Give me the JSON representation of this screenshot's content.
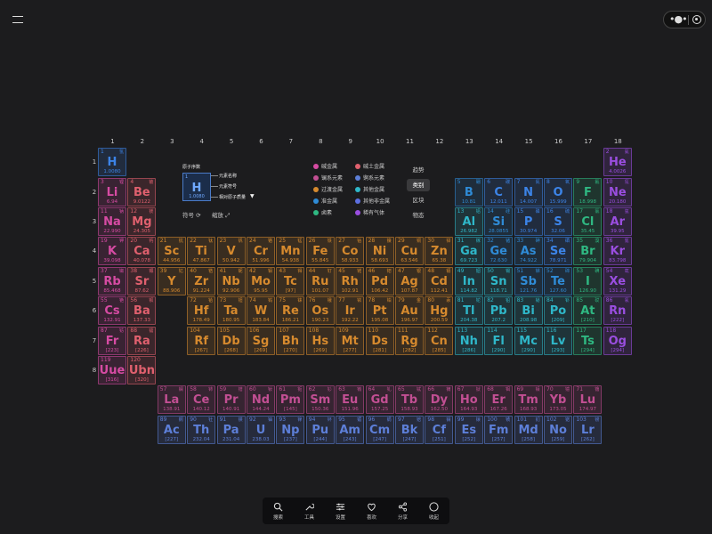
{
  "columns": [
    "1",
    "2",
    "3",
    "4",
    "5",
    "6",
    "7",
    "8",
    "9",
    "10",
    "11",
    "12",
    "13",
    "14",
    "15",
    "16",
    "17",
    "18"
  ],
  "rows": [
    "1",
    "2",
    "3",
    "4",
    "5",
    "6",
    "7",
    "8"
  ],
  "legend_key": {
    "atomic_number_label": "原子序数",
    "element_name_label": "元素名称",
    "element_symbol_label": "元素符号",
    "atomic_mass_label": "相对原子质量",
    "sample_number": "1",
    "sample_symbol": "H",
    "sample_mass": "1.0080"
  },
  "tools": {
    "symbol_label": "符号",
    "zoom_label": "缩放"
  },
  "categories": [
    {
      "label": "碱金属",
      "color": "#d64ba3"
    },
    {
      "label": "碱土金属",
      "color": "#e0606e"
    },
    {
      "label": "镧系元素",
      "color": "#c24f93"
    },
    {
      "label": "锕系元素",
      "color": "#5d7fd8"
    },
    {
      "label": "过渡金属",
      "color": "#d68a2e"
    },
    {
      "label": "其他金属",
      "color": "#2fb7c9"
    },
    {
      "label": "准金属",
      "color": "#2f8bd6"
    },
    {
      "label": "其他非金属",
      "color": "#5c6fe0"
    },
    {
      "label": "卤素",
      "color": "#2fb882"
    },
    {
      "label": "稀有气体",
      "color": "#9a4ee0"
    }
  ],
  "view_tabs": [
    {
      "label": "趋势",
      "active": false
    },
    {
      "label": "类别",
      "active": true
    },
    {
      "label": "区块",
      "active": false
    },
    {
      "label": "物态",
      "active": false
    }
  ],
  "bottom_bar": [
    {
      "label": "搜索",
      "icon": "search-icon"
    },
    {
      "label": "工具",
      "icon": "wrench-icon"
    },
    {
      "label": "设置",
      "icon": "sliders-icon"
    },
    {
      "label": "喜欢",
      "icon": "heart-icon"
    },
    {
      "label": "分享",
      "icon": "share-icon"
    },
    {
      "label": "收起",
      "icon": "collapse-icon"
    }
  ],
  "category_colors": {
    "alkali": "#d64ba3",
    "alkaline": "#e0606e",
    "transition": "#d68a2e",
    "post": "#2fb7c9",
    "metalloid": "#2f8bd6",
    "nonmetal": "#3c84e8",
    "halogen": "#2fb882",
    "noble": "#9a4ee0",
    "lanthanide": "#c24f93",
    "actinide": "#5d7fd8"
  },
  "elements": [
    {
      "n": "1",
      "s": "H",
      "c": "氢",
      "m": "1.0080",
      "g": 1,
      "p": 1,
      "cat": "nonmetal"
    },
    {
      "n": "2",
      "s": "He",
      "c": "氦",
      "m": "4.0026",
      "g": 18,
      "p": 1,
      "cat": "noble"
    },
    {
      "n": "3",
      "s": "Li",
      "c": "锂",
      "m": "6.94",
      "g": 1,
      "p": 2,
      "cat": "alkali"
    },
    {
      "n": "4",
      "s": "Be",
      "c": "铍",
      "m": "9.0122",
      "g": 2,
      "p": 2,
      "cat": "alkaline"
    },
    {
      "n": "5",
      "s": "B",
      "c": "硼",
      "m": "10.81",
      "g": 13,
      "p": 2,
      "cat": "metalloid"
    },
    {
      "n": "6",
      "s": "C",
      "c": "碳",
      "m": "12.011",
      "g": 14,
      "p": 2,
      "cat": "nonmetal"
    },
    {
      "n": "7",
      "s": "N",
      "c": "氮",
      "m": "14.007",
      "g": 15,
      "p": 2,
      "cat": "nonmetal"
    },
    {
      "n": "8",
      "s": "O",
      "c": "氧",
      "m": "15.999",
      "g": 16,
      "p": 2,
      "cat": "nonmetal"
    },
    {
      "n": "9",
      "s": "F",
      "c": "氟",
      "m": "18.998",
      "g": 17,
      "p": 2,
      "cat": "halogen"
    },
    {
      "n": "10",
      "s": "Ne",
      "c": "氖",
      "m": "20.180",
      "g": 18,
      "p": 2,
      "cat": "noble"
    },
    {
      "n": "11",
      "s": "Na",
      "c": "钠",
      "m": "22.990",
      "g": 1,
      "p": 3,
      "cat": "alkali"
    },
    {
      "n": "12",
      "s": "Mg",
      "c": "镁",
      "m": "24.305",
      "g": 2,
      "p": 3,
      "cat": "alkaline"
    },
    {
      "n": "13",
      "s": "Al",
      "c": "铝",
      "m": "26.982",
      "g": 13,
      "p": 3,
      "cat": "post"
    },
    {
      "n": "14",
      "s": "Si",
      "c": "硅",
      "m": "28.0855",
      "g": 14,
      "p": 3,
      "cat": "metalloid"
    },
    {
      "n": "15",
      "s": "P",
      "c": "磷",
      "m": "30.974",
      "g": 15,
      "p": 3,
      "cat": "nonmetal"
    },
    {
      "n": "16",
      "s": "S",
      "c": "硫",
      "m": "32.06",
      "g": 16,
      "p": 3,
      "cat": "nonmetal"
    },
    {
      "n": "17",
      "s": "Cl",
      "c": "氯",
      "m": "35.45",
      "g": 17,
      "p": 3,
      "cat": "halogen"
    },
    {
      "n": "18",
      "s": "Ar",
      "c": "氩",
      "m": "39.95",
      "g": 18,
      "p": 3,
      "cat": "noble"
    },
    {
      "n": "19",
      "s": "K",
      "c": "钾",
      "m": "39.098",
      "g": 1,
      "p": 4,
      "cat": "alkali"
    },
    {
      "n": "20",
      "s": "Ca",
      "c": "钙",
      "m": "40.078",
      "g": 2,
      "p": 4,
      "cat": "alkaline"
    },
    {
      "n": "21",
      "s": "Sc",
      "c": "钪",
      "m": "44.956",
      "g": 3,
      "p": 4,
      "cat": "transition"
    },
    {
      "n": "22",
      "s": "Ti",
      "c": "钛",
      "m": "47.867",
      "g": 4,
      "p": 4,
      "cat": "transition"
    },
    {
      "n": "23",
      "s": "V",
      "c": "钒",
      "m": "50.942",
      "g": 5,
      "p": 4,
      "cat": "transition"
    },
    {
      "n": "24",
      "s": "Cr",
      "c": "铬",
      "m": "51.996",
      "g": 6,
      "p": 4,
      "cat": "transition"
    },
    {
      "n": "25",
      "s": "Mn",
      "c": "锰",
      "m": "54.938",
      "g": 7,
      "p": 4,
      "cat": "transition"
    },
    {
      "n": "26",
      "s": "Fe",
      "c": "铁",
      "m": "55.845",
      "g": 8,
      "p": 4,
      "cat": "transition"
    },
    {
      "n": "27",
      "s": "Co",
      "c": "钴",
      "m": "58.933",
      "g": 9,
      "p": 4,
      "cat": "transition"
    },
    {
      "n": "28",
      "s": "Ni",
      "c": "镍",
      "m": "58.693",
      "g": 10,
      "p": 4,
      "cat": "transition"
    },
    {
      "n": "29",
      "s": "Cu",
      "c": "铜",
      "m": "63.546",
      "g": 11,
      "p": 4,
      "cat": "transition"
    },
    {
      "n": "30",
      "s": "Zn",
      "c": "锌",
      "m": "65.38",
      "g": 12,
      "p": 4,
      "cat": "transition"
    },
    {
      "n": "31",
      "s": "Ga",
      "c": "镓",
      "m": "69.723",
      "g": 13,
      "p": 4,
      "cat": "post"
    },
    {
      "n": "32",
      "s": "Ge",
      "c": "锗",
      "m": "72.630",
      "g": 14,
      "p": 4,
      "cat": "metalloid"
    },
    {
      "n": "33",
      "s": "As",
      "c": "砷",
      "m": "74.922",
      "g": 15,
      "p": 4,
      "cat": "metalloid"
    },
    {
      "n": "34",
      "s": "Se",
      "c": "硒",
      "m": "78.971",
      "g": 16,
      "p": 4,
      "cat": "nonmetal"
    },
    {
      "n": "35",
      "s": "Br",
      "c": "溴",
      "m": "79.904",
      "g": 17,
      "p": 4,
      "cat": "halogen"
    },
    {
      "n": "36",
      "s": "Kr",
      "c": "氪",
      "m": "83.798",
      "g": 18,
      "p": 4,
      "cat": "noble"
    },
    {
      "n": "37",
      "s": "Rb",
      "c": "铷",
      "m": "85.468",
      "g": 1,
      "p": 5,
      "cat": "alkali"
    },
    {
      "n": "38",
      "s": "Sr",
      "c": "锶",
      "m": "87.62",
      "g": 2,
      "p": 5,
      "cat": "alkaline"
    },
    {
      "n": "39",
      "s": "Y",
      "c": "钇",
      "m": "88.906",
      "g": 3,
      "p": 5,
      "cat": "transition"
    },
    {
      "n": "40",
      "s": "Zr",
      "c": "锆",
      "m": "91.224",
      "g": 4,
      "p": 5,
      "cat": "transition"
    },
    {
      "n": "41",
      "s": "Nb",
      "c": "铌",
      "m": "92.906",
      "g": 5,
      "p": 5,
      "cat": "transition"
    },
    {
      "n": "42",
      "s": "Mo",
      "c": "钼",
      "m": "95.95",
      "g": 6,
      "p": 5,
      "cat": "transition"
    },
    {
      "n": "43",
      "s": "Tc",
      "c": "锝",
      "m": "[97]",
      "g": 7,
      "p": 5,
      "cat": "transition"
    },
    {
      "n": "44",
      "s": "Ru",
      "c": "钌",
      "m": "101.07",
      "g": 8,
      "p": 5,
      "cat": "transition"
    },
    {
      "n": "45",
      "s": "Rh",
      "c": "铑",
      "m": "102.91",
      "g": 9,
      "p": 5,
      "cat": "transition"
    },
    {
      "n": "46",
      "s": "Pd",
      "c": "钯",
      "m": "106.42",
      "g": 10,
      "p": 5,
      "cat": "transition"
    },
    {
      "n": "47",
      "s": "Ag",
      "c": "银",
      "m": "107.87",
      "g": 11,
      "p": 5,
      "cat": "transition"
    },
    {
      "n": "48",
      "s": "Cd",
      "c": "镉",
      "m": "112.41",
      "g": 12,
      "p": 5,
      "cat": "transition"
    },
    {
      "n": "49",
      "s": "In",
      "c": "铟",
      "m": "114.82",
      "g": 13,
      "p": 5,
      "cat": "post"
    },
    {
      "n": "50",
      "s": "Sn",
      "c": "锡",
      "m": "118.71",
      "g": 14,
      "p": 5,
      "cat": "post"
    },
    {
      "n": "51",
      "s": "Sb",
      "c": "锑",
      "m": "121.76",
      "g": 15,
      "p": 5,
      "cat": "metalloid"
    },
    {
      "n": "52",
      "s": "Te",
      "c": "碲",
      "m": "127.60",
      "g": 16,
      "p": 5,
      "cat": "metalloid"
    },
    {
      "n": "53",
      "s": "I",
      "c": "碘",
      "m": "126.90",
      "g": 17,
      "p": 5,
      "cat": "halogen"
    },
    {
      "n": "54",
      "s": "Xe",
      "c": "氙",
      "m": "131.29",
      "g": 18,
      "p": 5,
      "cat": "noble"
    },
    {
      "n": "55",
      "s": "Cs",
      "c": "铯",
      "m": "132.91",
      "g": 1,
      "p": 6,
      "cat": "alkali"
    },
    {
      "n": "56",
      "s": "Ba",
      "c": "钡",
      "m": "137.33",
      "g": 2,
      "p": 6,
      "cat": "alkaline"
    },
    {
      "n": "72",
      "s": "Hf",
      "c": "铪",
      "m": "178.49",
      "g": 4,
      "p": 6,
      "cat": "transition"
    },
    {
      "n": "73",
      "s": "Ta",
      "c": "钽",
      "m": "180.95",
      "g": 5,
      "p": 6,
      "cat": "transition"
    },
    {
      "n": "74",
      "s": "W",
      "c": "钨",
      "m": "183.84",
      "g": 6,
      "p": 6,
      "cat": "transition"
    },
    {
      "n": "75",
      "s": "Re",
      "c": "铼",
      "m": "186.21",
      "g": 7,
      "p": 6,
      "cat": "transition"
    },
    {
      "n": "76",
      "s": "Os",
      "c": "锇",
      "m": "190.23",
      "g": 8,
      "p": 6,
      "cat": "transition"
    },
    {
      "n": "77",
      "s": "Ir",
      "c": "铱",
      "m": "192.22",
      "g": 9,
      "p": 6,
      "cat": "transition"
    },
    {
      "n": "78",
      "s": "Pt",
      "c": "铂",
      "m": "195.08",
      "g": 10,
      "p": 6,
      "cat": "transition"
    },
    {
      "n": "79",
      "s": "Au",
      "c": "金",
      "m": "196.97",
      "g": 11,
      "p": 6,
      "cat": "transition"
    },
    {
      "n": "80",
      "s": "Hg",
      "c": "汞",
      "m": "200.59",
      "g": 12,
      "p": 6,
      "cat": "transition"
    },
    {
      "n": "81",
      "s": "Tl",
      "c": "铊",
      "m": "204.38",
      "g": 13,
      "p": 6,
      "cat": "post"
    },
    {
      "n": "82",
      "s": "Pb",
      "c": "铅",
      "m": "207.2",
      "g": 14,
      "p": 6,
      "cat": "post"
    },
    {
      "n": "83",
      "s": "Bi",
      "c": "铋",
      "m": "208.98",
      "g": 15,
      "p": 6,
      "cat": "post"
    },
    {
      "n": "84",
      "s": "Po",
      "c": "钋",
      "m": "[209]",
      "g": 16,
      "p": 6,
      "cat": "post"
    },
    {
      "n": "85",
      "s": "At",
      "c": "砹",
      "m": "[210]",
      "g": 17,
      "p": 6,
      "cat": "halogen"
    },
    {
      "n": "86",
      "s": "Rn",
      "c": "氡",
      "m": "[222]",
      "g": 18,
      "p": 6,
      "cat": "noble"
    },
    {
      "n": "87",
      "s": "Fr",
      "c": "钫",
      "m": "[223]",
      "g": 1,
      "p": 7,
      "cat": "alkali"
    },
    {
      "n": "88",
      "s": "Ra",
      "c": "镭",
      "m": "[226]",
      "g": 2,
      "p": 7,
      "cat": "alkaline"
    },
    {
      "n": "104",
      "s": "Rf",
      "c": "",
      "m": "[267]",
      "g": 4,
      "p": 7,
      "cat": "transition"
    },
    {
      "n": "105",
      "s": "Db",
      "c": "",
      "m": "[268]",
      "g": 5,
      "p": 7,
      "cat": "transition"
    },
    {
      "n": "106",
      "s": "Sg",
      "c": "",
      "m": "[269]",
      "g": 6,
      "p": 7,
      "cat": "transition"
    },
    {
      "n": "107",
      "s": "Bh",
      "c": "",
      "m": "[270]",
      "g": 7,
      "p": 7,
      "cat": "transition"
    },
    {
      "n": "108",
      "s": "Hs",
      "c": "",
      "m": "[269]",
      "g": 8,
      "p": 7,
      "cat": "transition"
    },
    {
      "n": "109",
      "s": "Mt",
      "c": "",
      "m": "[277]",
      "g": 9,
      "p": 7,
      "cat": "transition"
    },
    {
      "n": "110",
      "s": "Ds",
      "c": "",
      "m": "[281]",
      "g": 10,
      "p": 7,
      "cat": "transition"
    },
    {
      "n": "111",
      "s": "Rg",
      "c": "",
      "m": "[282]",
      "g": 11,
      "p": 7,
      "cat": "transition"
    },
    {
      "n": "112",
      "s": "Cn",
      "c": "",
      "m": "[285]",
      "g": 12,
      "p": 7,
      "cat": "transition"
    },
    {
      "n": "113",
      "s": "Nh",
      "c": "",
      "m": "[286]",
      "g": 13,
      "p": 7,
      "cat": "post"
    },
    {
      "n": "114",
      "s": "Fl",
      "c": "",
      "m": "[290]",
      "g": 14,
      "p": 7,
      "cat": "post"
    },
    {
      "n": "115",
      "s": "Mc",
      "c": "",
      "m": "[290]",
      "g": 15,
      "p": 7,
      "cat": "post"
    },
    {
      "n": "116",
      "s": "Lv",
      "c": "",
      "m": "[293]",
      "g": 16,
      "p": 7,
      "cat": "post"
    },
    {
      "n": "117",
      "s": "Ts",
      "c": "",
      "m": "[294]",
      "g": 17,
      "p": 7,
      "cat": "halogen"
    },
    {
      "n": "118",
      "s": "Og",
      "c": "",
      "m": "[294]",
      "g": 18,
      "p": 7,
      "cat": "noble"
    },
    {
      "n": "119",
      "s": "Uue",
      "c": "",
      "m": "[316]",
      "g": 1,
      "p": 8,
      "cat": "alkali"
    },
    {
      "n": "120",
      "s": "Ubn",
      "c": "",
      "m": "[320]",
      "g": 2,
      "p": 8,
      "cat": "alkaline"
    },
    {
      "n": "57",
      "s": "La",
      "c": "镧",
      "m": "138.91",
      "g": 3,
      "p": 9,
      "cat": "lanthanide"
    },
    {
      "n": "58",
      "s": "Ce",
      "c": "铈",
      "m": "140.12",
      "g": 4,
      "p": 9,
      "cat": "lanthanide"
    },
    {
      "n": "59",
      "s": "Pr",
      "c": "镨",
      "m": "140.91",
      "g": 5,
      "p": 9,
      "cat": "lanthanide"
    },
    {
      "n": "60",
      "s": "Nd",
      "c": "钕",
      "m": "144.24",
      "g": 6,
      "p": 9,
      "cat": "lanthanide"
    },
    {
      "n": "61",
      "s": "Pm",
      "c": "钷",
      "m": "[145]",
      "g": 7,
      "p": 9,
      "cat": "lanthanide"
    },
    {
      "n": "62",
      "s": "Sm",
      "c": "钐",
      "m": "150.36",
      "g": 8,
      "p": 9,
      "cat": "lanthanide"
    },
    {
      "n": "63",
      "s": "Eu",
      "c": "铕",
      "m": "151.96",
      "g": 9,
      "p": 9,
      "cat": "lanthanide"
    },
    {
      "n": "64",
      "s": "Gd",
      "c": "钆",
      "m": "157.25",
      "g": 10,
      "p": 9,
      "cat": "lanthanide"
    },
    {
      "n": "65",
      "s": "Tb",
      "c": "铽",
      "m": "158.93",
      "g": 11,
      "p": 9,
      "cat": "lanthanide"
    },
    {
      "n": "66",
      "s": "Dy",
      "c": "镝",
      "m": "162.50",
      "g": 12,
      "p": 9,
      "cat": "lanthanide"
    },
    {
      "n": "67",
      "s": "Ho",
      "c": "钬",
      "m": "164.93",
      "g": 13,
      "p": 9,
      "cat": "lanthanide"
    },
    {
      "n": "68",
      "s": "Er",
      "c": "铒",
      "m": "167.26",
      "g": 14,
      "p": 9,
      "cat": "lanthanide"
    },
    {
      "n": "69",
      "s": "Tm",
      "c": "铥",
      "m": "168.93",
      "g": 15,
      "p": 9,
      "cat": "lanthanide"
    },
    {
      "n": "70",
      "s": "Yb",
      "c": "镱",
      "m": "173.05",
      "g": 16,
      "p": 9,
      "cat": "lanthanide"
    },
    {
      "n": "71",
      "s": "Lu",
      "c": "镥",
      "m": "174.97",
      "g": 17,
      "p": 9,
      "cat": "lanthanide"
    },
    {
      "n": "89",
      "s": "Ac",
      "c": "锕",
      "m": "[227]",
      "g": 3,
      "p": 10,
      "cat": "actinide"
    },
    {
      "n": "90",
      "s": "Th",
      "c": "钍",
      "m": "232.04",
      "g": 4,
      "p": 10,
      "cat": "actinide"
    },
    {
      "n": "91",
      "s": "Pa",
      "c": "镤",
      "m": "231.04",
      "g": 5,
      "p": 10,
      "cat": "actinide"
    },
    {
      "n": "92",
      "s": "U",
      "c": "铀",
      "m": "238.03",
      "g": 6,
      "p": 10,
      "cat": "actinide"
    },
    {
      "n": "93",
      "s": "Np",
      "c": "镎",
      "m": "[237]",
      "g": 7,
      "p": 10,
      "cat": "actinide"
    },
    {
      "n": "94",
      "s": "Pu",
      "c": "钚",
      "m": "[244]",
      "g": 8,
      "p": 10,
      "cat": "actinide"
    },
    {
      "n": "95",
      "s": "Am",
      "c": "镅",
      "m": "[243]",
      "g": 9,
      "p": 10,
      "cat": "actinide"
    },
    {
      "n": "96",
      "s": "Cm",
      "c": "锔",
      "m": "[247]",
      "g": 10,
      "p": 10,
      "cat": "actinide"
    },
    {
      "n": "97",
      "s": "Bk",
      "c": "锫",
      "m": "[247]",
      "g": 11,
      "p": 10,
      "cat": "actinide"
    },
    {
      "n": "98",
      "s": "Cf",
      "c": "锎",
      "m": "[251]",
      "g": 12,
      "p": 10,
      "cat": "actinide"
    },
    {
      "n": "99",
      "s": "Es",
      "c": "锿",
      "m": "[252]",
      "g": 13,
      "p": 10,
      "cat": "actinide"
    },
    {
      "n": "100",
      "s": "Fm",
      "c": "镄",
      "m": "[257]",
      "g": 14,
      "p": 10,
      "cat": "actinide"
    },
    {
      "n": "101",
      "s": "Md",
      "c": "钔",
      "m": "[258]",
      "g": 15,
      "p": 10,
      "cat": "actinide"
    },
    {
      "n": "102",
      "s": "No",
      "c": "锘",
      "m": "[259]",
      "g": 16,
      "p": 10,
      "cat": "actinide"
    },
    {
      "n": "103",
      "s": "Lr",
      "c": "铹",
      "m": "[262]",
      "g": 17,
      "p": 10,
      "cat": "actinide"
    }
  ]
}
